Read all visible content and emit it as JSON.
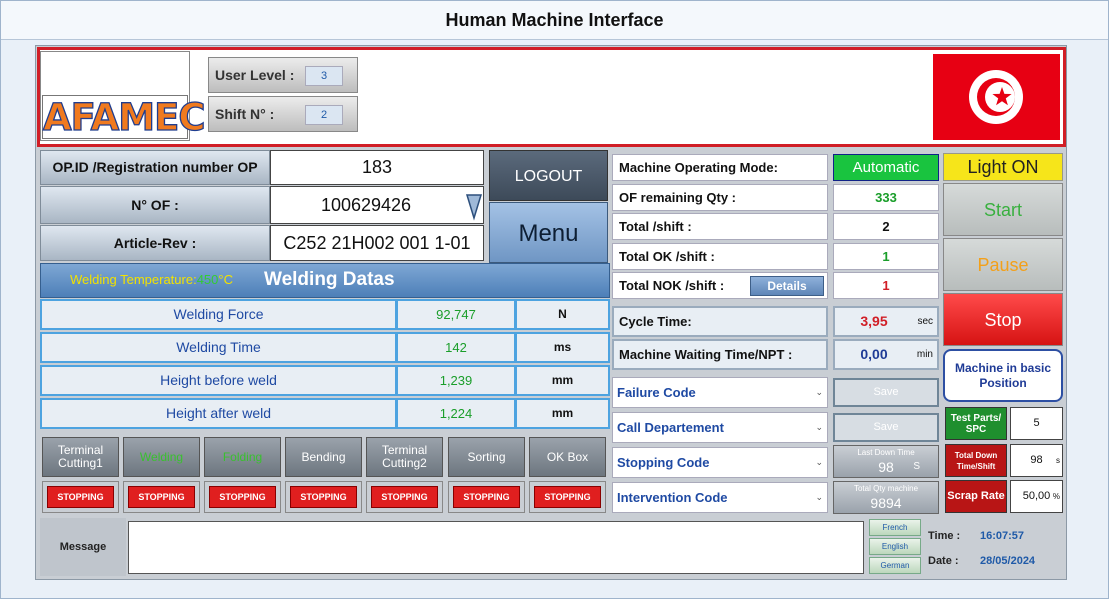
{
  "window": {
    "title": "Human Machine Interface"
  },
  "header": {
    "logo": "AFAMEC",
    "user_level_label": "User Level :",
    "user_level_value": "3",
    "shift_label": "Shift N° :",
    "shift_value": "2",
    "flag_colors": {
      "field": "#e70013",
      "disc": "#ffffff"
    }
  },
  "op": {
    "op_id_label": "OP.ID /Registration number OP",
    "op_id_value": "183",
    "of_label": "N° OF :",
    "of_value": "100629426",
    "article_label": "Article-Rev :",
    "article_value": "C252 21H002 001 1-01"
  },
  "actions": {
    "logout_label": "LOGOUT",
    "menu_label": "Menu"
  },
  "welding": {
    "temp_label": "Welding Temperature:",
    "temp_value": "450",
    "temp_unit": "°C",
    "title": "Welding Datas",
    "rows": [
      {
        "name": "Welding Force",
        "value": "92,747",
        "unit": "N"
      },
      {
        "name": "Welding Time",
        "value": "142",
        "unit": "ms"
      },
      {
        "name": "Height before weld",
        "value": "1,239",
        "unit": "mm"
      },
      {
        "name": "Height after weld",
        "value": "1,224",
        "unit": "mm"
      }
    ]
  },
  "stations": [
    {
      "label": "Terminal Cutting1",
      "status": "STOPPING"
    },
    {
      "label": "Welding",
      "status": "STOPPING"
    },
    {
      "label": "Folding",
      "status": "STOPPING"
    },
    {
      "label": "Bending",
      "status": "STOPPING"
    },
    {
      "label": "Terminal Cutting2",
      "status": "STOPPING"
    },
    {
      "label": "Sorting",
      "status": "STOPPING"
    },
    {
      "label": "OK Box",
      "status": "STOPPING"
    }
  ],
  "message": {
    "label": "Message",
    "value": ""
  },
  "languages": [
    "French",
    "English",
    "German"
  ],
  "clock": {
    "time_label": "Time :",
    "time_value": "16:07:57",
    "date_label": "Date :",
    "date_value": "28/05/2024"
  },
  "machine": {
    "mode_label": "Machine Operating Mode:",
    "mode_value": "Automatic",
    "of_remaining_label": "OF remaining Qty :",
    "of_remaining_value": "333",
    "total_shift_label": "Total /shift :",
    "total_shift_value": "2",
    "total_ok_label": "Total OK /shift :",
    "total_ok_value": "1",
    "total_nok_label": "Total NOK /shift :",
    "total_nok_value": "1",
    "details_label": "Details",
    "cycle_label": "Cycle Time:",
    "cycle_value": "3,95",
    "cycle_unit": "sec",
    "waiting_label": "Machine Waiting Time/NPT :",
    "waiting_value": "0,00",
    "waiting_unit": "min",
    "failure_label": "Failure Code",
    "call_label": "Call Departement",
    "stopping_label": "Stopping Code",
    "intervention_label": "Intervention Code",
    "save_label": "Save",
    "last_down_label": "Last Down Time",
    "last_down_value": "98",
    "last_down_unit": "S",
    "total_qty_label": "Total Qty machine",
    "total_qty_value": "9894"
  },
  "controls": {
    "light_label": "Light ON",
    "start_label": "Start",
    "pause_label": "Pause",
    "stop_label": "Stop",
    "basic_label": "Machine in basic Position",
    "test_parts_label": "Test Parts/ SPC",
    "test_parts_value": "5",
    "total_down_label": "Total Down Time/Shift",
    "total_down_value": "98",
    "total_down_unit": "s",
    "scrap_label": "Scrap Rate",
    "scrap_value": "50,00",
    "scrap_unit": "%"
  }
}
